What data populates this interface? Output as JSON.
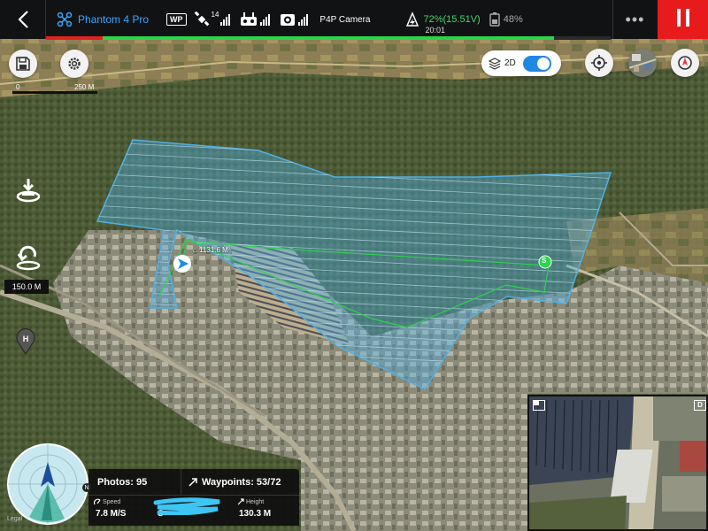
{
  "topbar": {
    "aircraft_name": "Phantom 4 Pro",
    "wp_badge": "WP",
    "satellite_count": "14",
    "camera_label": "P4P Camera",
    "battery_text": "72%(15.51V)",
    "flight_time": "20:01",
    "rc_battery": "48%",
    "more_label": "•••",
    "progress_green": 0.9,
    "progress_red": 0.1
  },
  "map": {
    "scale_start": "0",
    "scale_end": "250 M",
    "view_mode": "2D",
    "view_toggle_on": true,
    "altitude_label": "150.0 M",
    "distance_label": "1131.6 M",
    "start_marker": "S",
    "legal": "Legal"
  },
  "telemetry": {
    "photos_text": "Photos: 95",
    "waypoints_text": "Waypoints: 53/72",
    "speed_caption": "Speed",
    "speed_value": "7.8 M/S",
    "distance_value": "S",
    "height_caption": "Height",
    "height_value": "130.3 M",
    "compass_marker": "N"
  },
  "fpv": {
    "camera_toggle_label": "D"
  },
  "colors": {
    "accent_blue": "#3aa7ff",
    "battery_green": "#48d66a",
    "stop_red": "#e71b1b",
    "route_green": "#2bd44b",
    "mission_area": "#4fb0e6"
  }
}
